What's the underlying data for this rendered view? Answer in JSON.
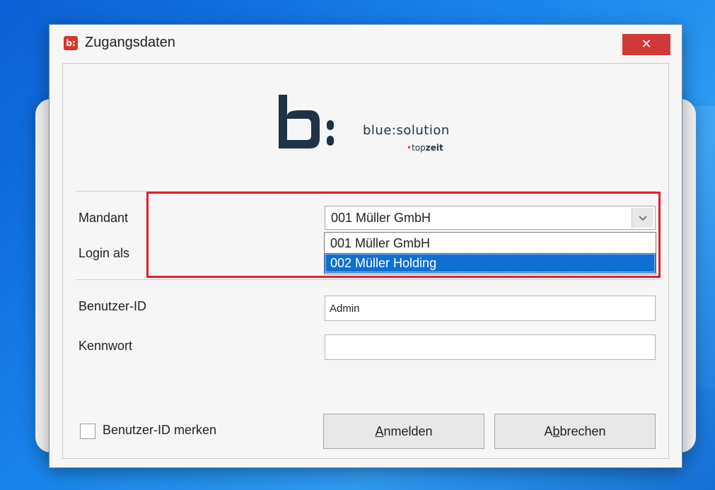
{
  "window": {
    "title": "Zugangsdaten",
    "app_icon": "b:",
    "close_label": "✕"
  },
  "logo": {
    "mark": "b:",
    "name": "blue:solution",
    "sub_dot": "•",
    "sub_top": "top",
    "sub_zeit": "zeit"
  },
  "form": {
    "mandant_label": "Mandant",
    "login_label": "Login als",
    "mandant_value": "001 Müller GmbH",
    "mandant_options": [
      "001 Müller GmbH",
      "002 Müller Holding"
    ],
    "selected_option_index": 1,
    "userid_label": "Benutzer-ID",
    "userid_value": "Admin",
    "password_label": "Kennwort",
    "password_value": "",
    "remember_label": "Benutzer-ID merken",
    "remember_checked": false
  },
  "buttons": {
    "login_underline": "A",
    "login_rest": "nmelden",
    "cancel_pre": "A",
    "cancel_underline": "b",
    "cancel_rest": "brechen"
  },
  "colors": {
    "highlight": "#e2202a",
    "selection": "#0f6fd3",
    "close": "#d1383a",
    "brand": "#1d3347"
  }
}
